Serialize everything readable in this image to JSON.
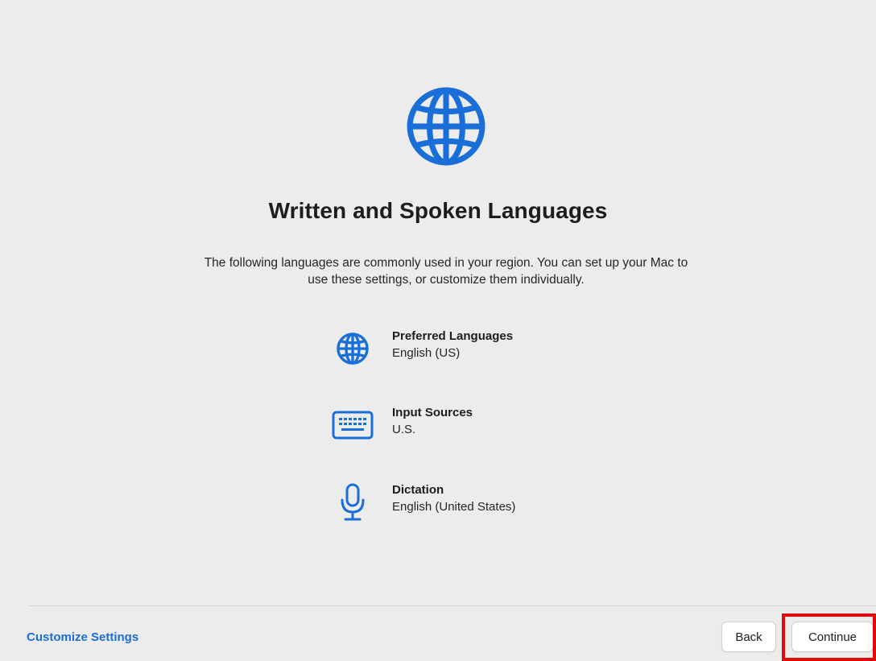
{
  "screen": {
    "title": "Written and Spoken Languages",
    "description": "The following languages are commonly used in your region. You can set up your Mac to use these settings, or customize them individually."
  },
  "settings": [
    {
      "icon": "globe-icon",
      "label": "Preferred Languages",
      "value": "English (US)"
    },
    {
      "icon": "keyboard-icon",
      "label": "Input Sources",
      "value": "U.S."
    },
    {
      "icon": "microphone-icon",
      "label": "Dictation",
      "value": "English (United States)"
    }
  ],
  "footer": {
    "customize_label": "Customize Settings",
    "back_label": "Back",
    "continue_label": "Continue"
  },
  "colors": {
    "accent": "#1a6ed8",
    "background": "#ececec",
    "highlight": "#e00a0a"
  }
}
